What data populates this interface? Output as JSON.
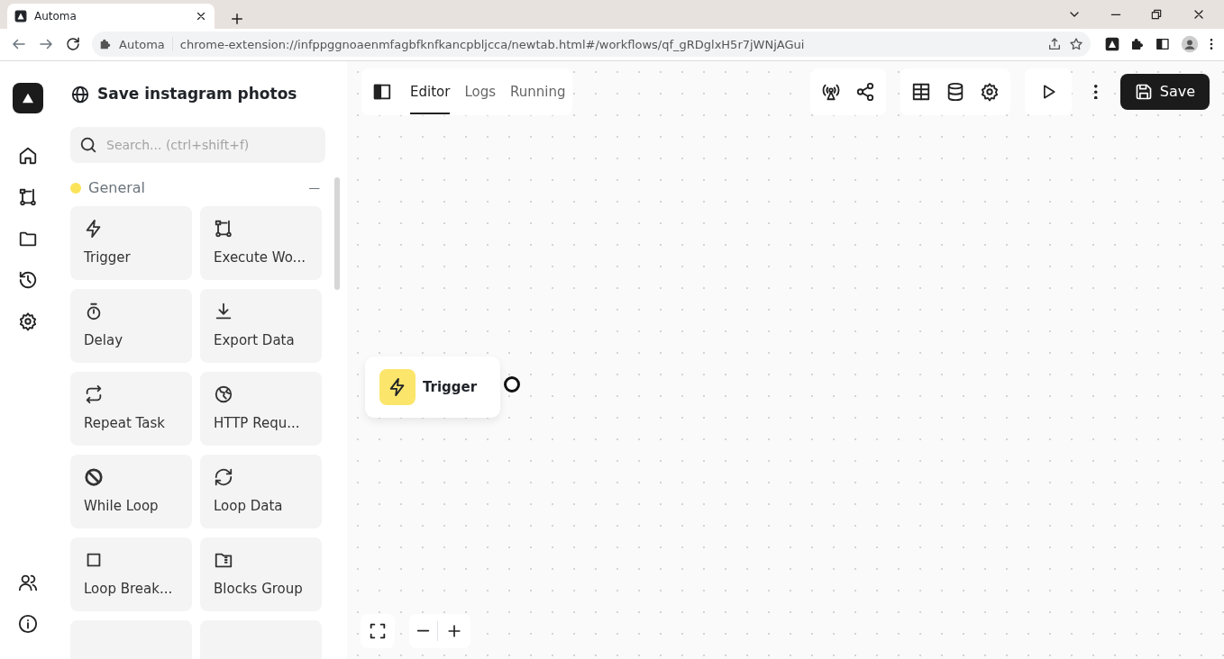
{
  "browser": {
    "tab_title": "Automa",
    "site_chip": "Automa",
    "url": "chrome-extension://infppggnoaenmfagbfknfkancpbljcca/newtab.html#/workflows/qf_gRDglxH5r7jWNjAGui"
  },
  "workflow": {
    "title": "Save instagram photos"
  },
  "search": {
    "placeholder": "Search... (ctrl+shift+f)"
  },
  "category": {
    "name": "General",
    "color": "#fbe45a",
    "expanded": true
  },
  "blocks": [
    {
      "label": "Trigger"
    },
    {
      "label": "Execute Wo..."
    },
    {
      "label": "Delay"
    },
    {
      "label": "Export Data"
    },
    {
      "label": "Repeat Task"
    },
    {
      "label": "HTTP Requ..."
    },
    {
      "label": "While Loop"
    },
    {
      "label": "Loop Data"
    },
    {
      "label": "Loop Break..."
    },
    {
      "label": "Blocks Group"
    }
  ],
  "tabs": [
    {
      "label": "Editor",
      "selected": true
    },
    {
      "label": "Logs",
      "selected": false
    },
    {
      "label": "Running",
      "selected": false
    }
  ],
  "save_button": "Save",
  "canvas": {
    "nodes": [
      {
        "label": "Trigger"
      }
    ]
  }
}
